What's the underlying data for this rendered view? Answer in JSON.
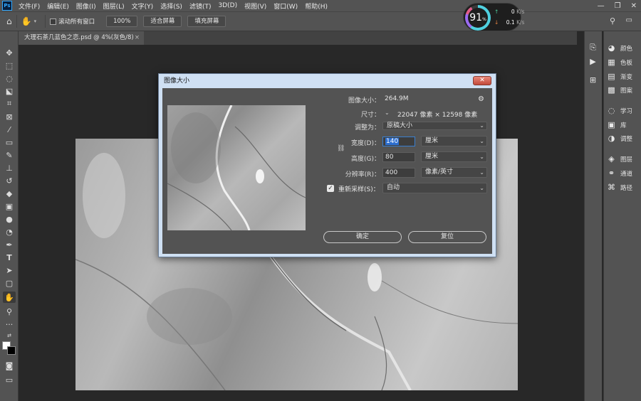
{
  "app": {
    "logo": "Ps"
  },
  "menu": [
    "文件(F)",
    "编辑(E)",
    "图像(I)",
    "图层(L)",
    "文字(Y)",
    "选择(S)",
    "滤镜(T)",
    "3D(D)",
    "视图(V)",
    "窗口(W)",
    "帮助(H)"
  ],
  "window_controls": {
    "minimize": "—",
    "restore": "❐",
    "close": "✕"
  },
  "optionsbar": {
    "scroll_all_label": "滚动所有窗口",
    "zoom_btn": "100%",
    "fit_btn": "适合屏幕",
    "fill_btn": "填充屏幕"
  },
  "document_tab": {
    "title": "大理石茶几蓝色之恋.psd @ 4%(灰色/8)",
    "close": "×"
  },
  "perf": {
    "value": "91",
    "unit": "%",
    "up": "0",
    "up_unit": "K/s",
    "down": "0.1",
    "down_unit": "K/s"
  },
  "right_panels": [
    {
      "label": "颜色",
      "icon": "palette-icon"
    },
    {
      "label": "色板",
      "icon": "swatches-icon"
    },
    {
      "label": "渐变",
      "icon": "gradient-icon"
    },
    {
      "label": "图案",
      "icon": "pattern-icon"
    },
    {
      "label": "学习",
      "icon": "learn-icon"
    },
    {
      "label": "库",
      "icon": "library-icon"
    },
    {
      "label": "调整",
      "icon": "adjust-icon"
    },
    {
      "label": "图层",
      "icon": "layers-icon"
    },
    {
      "label": "通道",
      "icon": "channels-icon"
    },
    {
      "label": "路径",
      "icon": "paths-icon"
    }
  ],
  "dialog": {
    "title": "图像大小",
    "close": "✕",
    "image_size_label": "图像大小：",
    "image_size_value": "264.9M",
    "dimensions_label": "尺寸：",
    "dimensions_value": "22047 像素 × 12598 像素",
    "fit_label": "调整为：",
    "fit_value": "原稿大小",
    "width_label": "宽度(D)：",
    "width_value": "140",
    "width_unit": "厘米",
    "height_label": "高度(G)：",
    "height_value": "80",
    "height_unit": "厘米",
    "resolution_label": "分辨率(R)：",
    "resolution_value": "400",
    "resolution_unit": "像素/英寸",
    "resample_label": "重新采样(S)：",
    "resample_value": "自动",
    "resample_checked": true,
    "ok_label": "确定",
    "cancel_label": "复位"
  }
}
